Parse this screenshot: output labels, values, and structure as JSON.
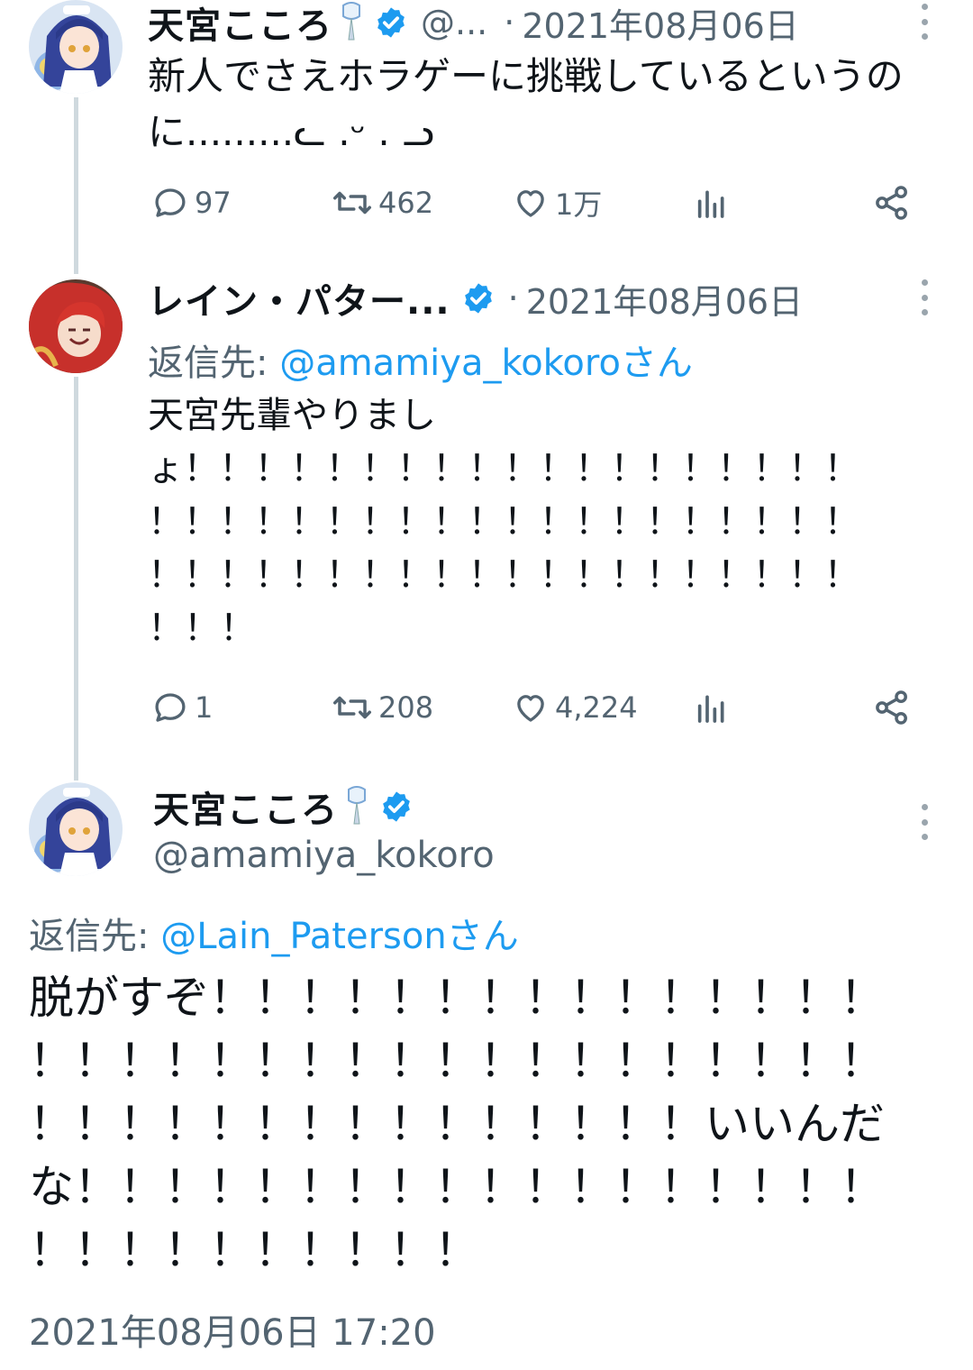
{
  "colors": {
    "accent": "#1d9bf0",
    "text": "#0f1419",
    "muted": "#536471",
    "thread_line": "#cfd9de"
  },
  "tweet1": {
    "name": "天宮こころ",
    "handle_truncated": "@...",
    "date": "2021年08月06日",
    "text_line1": "新人でさえホラゲーに挑戦しているというの",
    "text_line2": "に.........ᓚ .ᵕ . ᓗ",
    "replies": "97",
    "retweets": "462",
    "likes": "1万"
  },
  "tweet2": {
    "name": "レイン・パター...",
    "date": "2021年08月06日",
    "reply_label": "返信先: ",
    "reply_mention": "@amamiya_kokoroさん",
    "text_line1": "天宮先輩やりまし",
    "text_line2": "ょ！！！！！！！！！！！！！！！！！！！",
    "text_line3": "！！！！！！！！！！！！！！！！！！！！",
    "text_line4": "！！！！！！！！！！！！！！！！！！！！",
    "text_line5": "！！！",
    "replies": "1",
    "retweets": "208",
    "likes": "4,224"
  },
  "main_tweet": {
    "name": "天宮こころ",
    "handle": "@amamiya_kokoro",
    "reply_label": "返信先: ",
    "reply_mention": "@Lain_Patersonさん",
    "text_line1": "脱がすぞ！！！！！！！！！！！！！！！",
    "text_line2": "！！！！！！！！！！！！！！！！！！！",
    "text_line3": "！！！！！！！！！！！！！！！いいんだ",
    "text_line4": "な！！！！！！！！！！！！！！！！！！",
    "text_line5": "！！！！！！！！！！",
    "timestamp": "2021年08月06日 17:20"
  },
  "icons": {
    "reply": "speech-bubble-icon",
    "retweet": "retweet-arrows-icon",
    "like": "heart-icon",
    "views": "bar-chart-icon",
    "share": "share-nodes-icon",
    "verified": "verified-badge-icon",
    "bell": "wind-chime-icon",
    "more": "vertical-dots-icon"
  }
}
